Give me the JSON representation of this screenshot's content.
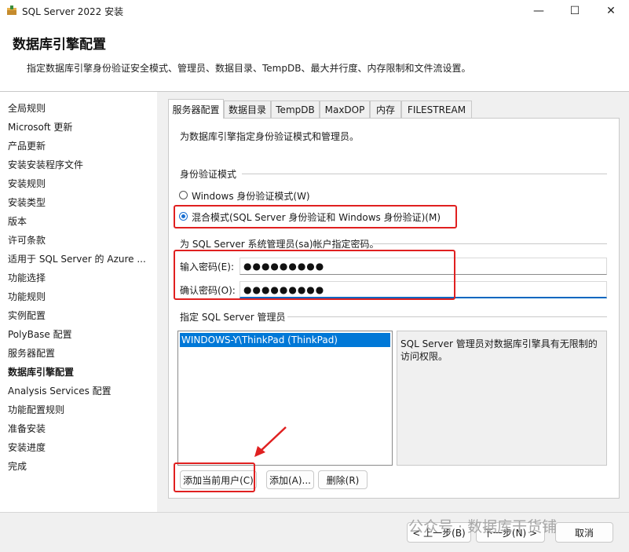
{
  "window": {
    "title": "SQL Server 2022 安装",
    "minimize": "—",
    "maximize": "☐",
    "close": "✕"
  },
  "header": {
    "title": "数据库引擎配置",
    "description": "指定数据库引擎身份验证安全模式、管理员、数据目录、TempDB、最大并行度、内存限制和文件流设置。"
  },
  "nav": {
    "items": [
      "全局规则",
      "Microsoft 更新",
      "产品更新",
      "安装安装程序文件",
      "安装规则",
      "安装类型",
      "版本",
      "许可条款",
      "适用于 SQL Server 的 Azure ...",
      "功能选择",
      "功能规则",
      "实例配置",
      "PolyBase 配置",
      "服务器配置",
      "数据库引擎配置",
      "Analysis Services 配置",
      "功能配置规则",
      "准备安装",
      "安装进度",
      "完成"
    ],
    "active_index": 14
  },
  "tabs": [
    "服务器配置",
    "数据目录",
    "TempDB",
    "MaxDOP",
    "内存",
    "FILESTREAM"
  ],
  "server_config": {
    "intro": "为数据库引擎指定身份验证模式和管理员。",
    "auth_section_label": "身份验证模式",
    "windows_auth_label": "Windows 身份验证模式(W)",
    "mixed_mode_label": "混合模式(SQL Server 身份验证和 Windows 身份验证)(M)",
    "selected_mode": "mixed",
    "sa_label": "为 SQL Server 系统管理员(sa)帐户指定密码。",
    "password_label": "输入密码(E):",
    "password_value": "●●●●●●●●●",
    "confirm_label": "确认密码(O):",
    "confirm_value": "●●●●●●●●●",
    "admins_section_label": "指定 SQL Server 管理员",
    "admins": [
      "WINDOWS-Y\\ThinkPad (ThinkPad)"
    ],
    "admin_description": "SQL Server 管理员对数据库引擎具有无限制的访问权限。",
    "add_current_user_label": "添加当前用户(C)",
    "add_label": "添加(A)...",
    "remove_label": "删除(R)"
  },
  "footer": {
    "back_label": "< 上一步(B)",
    "next_label": "下一步(N) >",
    "cancel_label": "取消",
    "watermark": "公众号 · 数据库干货铺"
  },
  "accent_color": "#0078d7",
  "highlight_color": "#e02020"
}
